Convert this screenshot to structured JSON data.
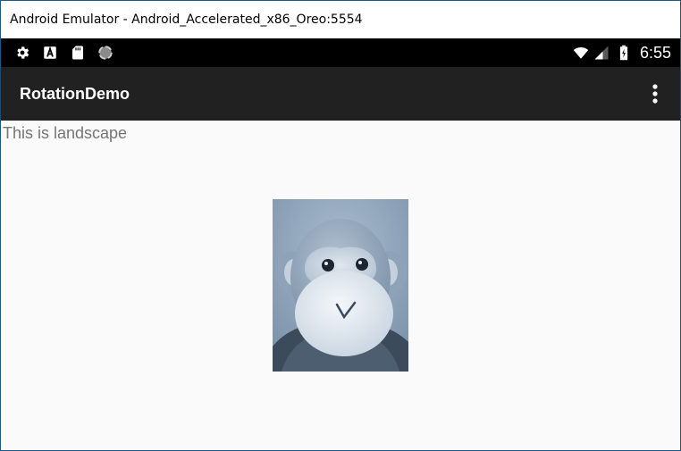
{
  "window": {
    "title": "Android Emulator - Android_Accelerated_x86_Oreo:5554"
  },
  "status_bar": {
    "left_icons": [
      "settings-icon",
      "font-icon",
      "sd-card-icon",
      "sync-circle-icon"
    ],
    "right_icons": [
      "wifi-icon",
      "cell-signal-icon",
      "battery-icon"
    ],
    "time": "6:55",
    "background": "#000000"
  },
  "app_bar": {
    "title": "RotationDemo",
    "overflow_icon": "more-vert-icon",
    "background": "#212121"
  },
  "content": {
    "label": "This is landscape",
    "image": "monkey-plush-photo",
    "background": "#fafafa"
  }
}
